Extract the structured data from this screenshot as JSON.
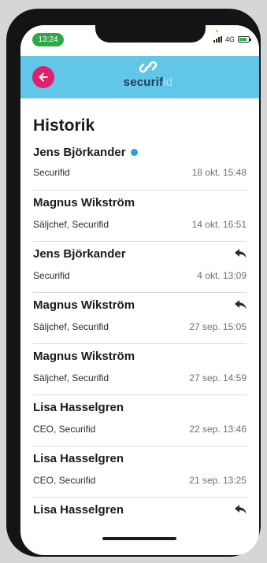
{
  "status_bar": {
    "time": "13:24",
    "network": "4G"
  },
  "header": {
    "logo_main": "securif",
    "logo_suffix": "id"
  },
  "page": {
    "title": "Historik"
  },
  "items": [
    {
      "name": "Jens Björkander",
      "subtitle": "Securifid",
      "date": "18 okt. 15:48",
      "unread": true,
      "replied": false
    },
    {
      "name": "Magnus Wikström",
      "subtitle": "Säljchef, Securifid",
      "date": "14 okt. 16:51",
      "unread": false,
      "replied": false
    },
    {
      "name": "Jens Björkander",
      "subtitle": "Securifid",
      "date": "4 okt. 13:09",
      "unread": false,
      "replied": true
    },
    {
      "name": "Magnus Wikström",
      "subtitle": "Säljchef, Securifid",
      "date": "27 sep. 15:05",
      "unread": false,
      "replied": true
    },
    {
      "name": "Magnus Wikström",
      "subtitle": "Säljchef, Securifid",
      "date": "27 sep. 14:59",
      "unread": false,
      "replied": false
    },
    {
      "name": "Lisa Hasselgren",
      "subtitle": "CEO, Securifid",
      "date": "22 sep. 13:46",
      "unread": false,
      "replied": false
    },
    {
      "name": "Lisa Hasselgren",
      "subtitle": "CEO, Securifid",
      "date": "21 sep. 13:25",
      "unread": false,
      "replied": false
    },
    {
      "name": "Lisa Hasselgren",
      "subtitle": "",
      "date": "",
      "unread": false,
      "replied": true
    }
  ],
  "colors": {
    "header_bg": "#62c6e8",
    "back_button": "#e0206e",
    "unread_dot": "#2b9fd6",
    "time_pill": "#2fa84a"
  },
  "icons": {
    "back": "arrow-left-icon",
    "reply": "reply-arrow-icon",
    "logo": "securifid-logo"
  }
}
